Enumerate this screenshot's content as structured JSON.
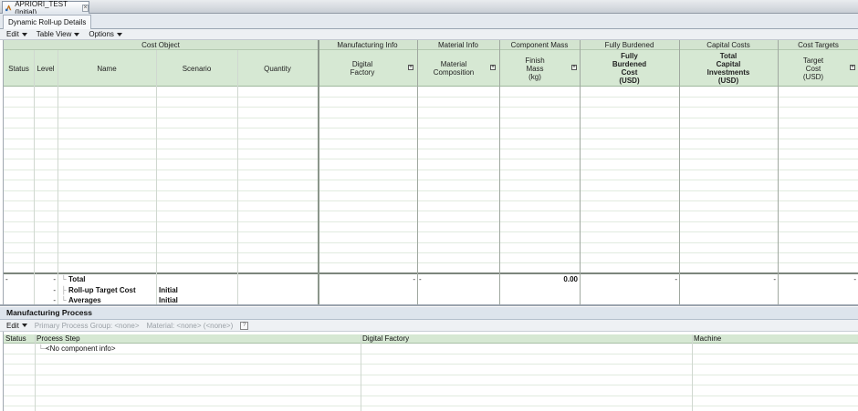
{
  "window": {
    "tab_title": "APRIORI_TEST (Initial)"
  },
  "view_tab": {
    "label": "Dynamic Roll-up Details"
  },
  "menubar": {
    "items": [
      {
        "label": "Edit"
      },
      {
        "label": "Table View"
      },
      {
        "label": "Options"
      }
    ]
  },
  "table": {
    "groups": [
      {
        "label": "Cost Object"
      },
      {
        "label": "Manufacturing Info"
      },
      {
        "label": "Material Info"
      },
      {
        "label": "Component Mass"
      },
      {
        "label": "Fully Burdened"
      },
      {
        "label": "Capital Costs"
      },
      {
        "label": "Cost Targets"
      }
    ],
    "columns": [
      {
        "label": "Status"
      },
      {
        "label": "Level"
      },
      {
        "label": "Name"
      },
      {
        "label": "Scenario"
      },
      {
        "label": "Quantity"
      },
      {
        "label": "Digital\nFactory"
      },
      {
        "label": "Material\nComposition"
      },
      {
        "label": "Finish\nMass\n(kg)"
      },
      {
        "label": "Fully\nBurdened\nCost\n(USD)"
      },
      {
        "label": "Total\nCapital\nInvestments\n(USD)"
      },
      {
        "label": "Target\nCost\n(USD)"
      }
    ],
    "summary": {
      "total": {
        "status": "-",
        "level": "-",
        "name": "Total",
        "digital_factory": "-",
        "material_composition": "-",
        "finish_mass": "0.00",
        "fully_burdened_cost": "-",
        "total_capital": "-",
        "target_cost": "-"
      },
      "rollup_target": {
        "level": "-",
        "name": "Roll-up Target Cost",
        "scenario": "Initial"
      },
      "averages": {
        "level": "-",
        "name": "Averages",
        "scenario": "Initial"
      }
    }
  },
  "manufacturing_process": {
    "title": "Manufacturing Process",
    "toolbar": {
      "edit": "Edit",
      "primary_process_group": "Primary Process Group: <none>",
      "material": "Material: <none> (<none>)"
    },
    "columns": [
      {
        "label": "Status"
      },
      {
        "label": "Process Step"
      },
      {
        "label": "Digital Factory"
      },
      {
        "label": "Machine"
      }
    ],
    "rows": [
      {
        "process_step": "<No component info>"
      }
    ]
  },
  "colors": {
    "header_green": "#d6e8d3",
    "group_green": "#d3e4d0",
    "grid_line": "#e1ebdf"
  }
}
